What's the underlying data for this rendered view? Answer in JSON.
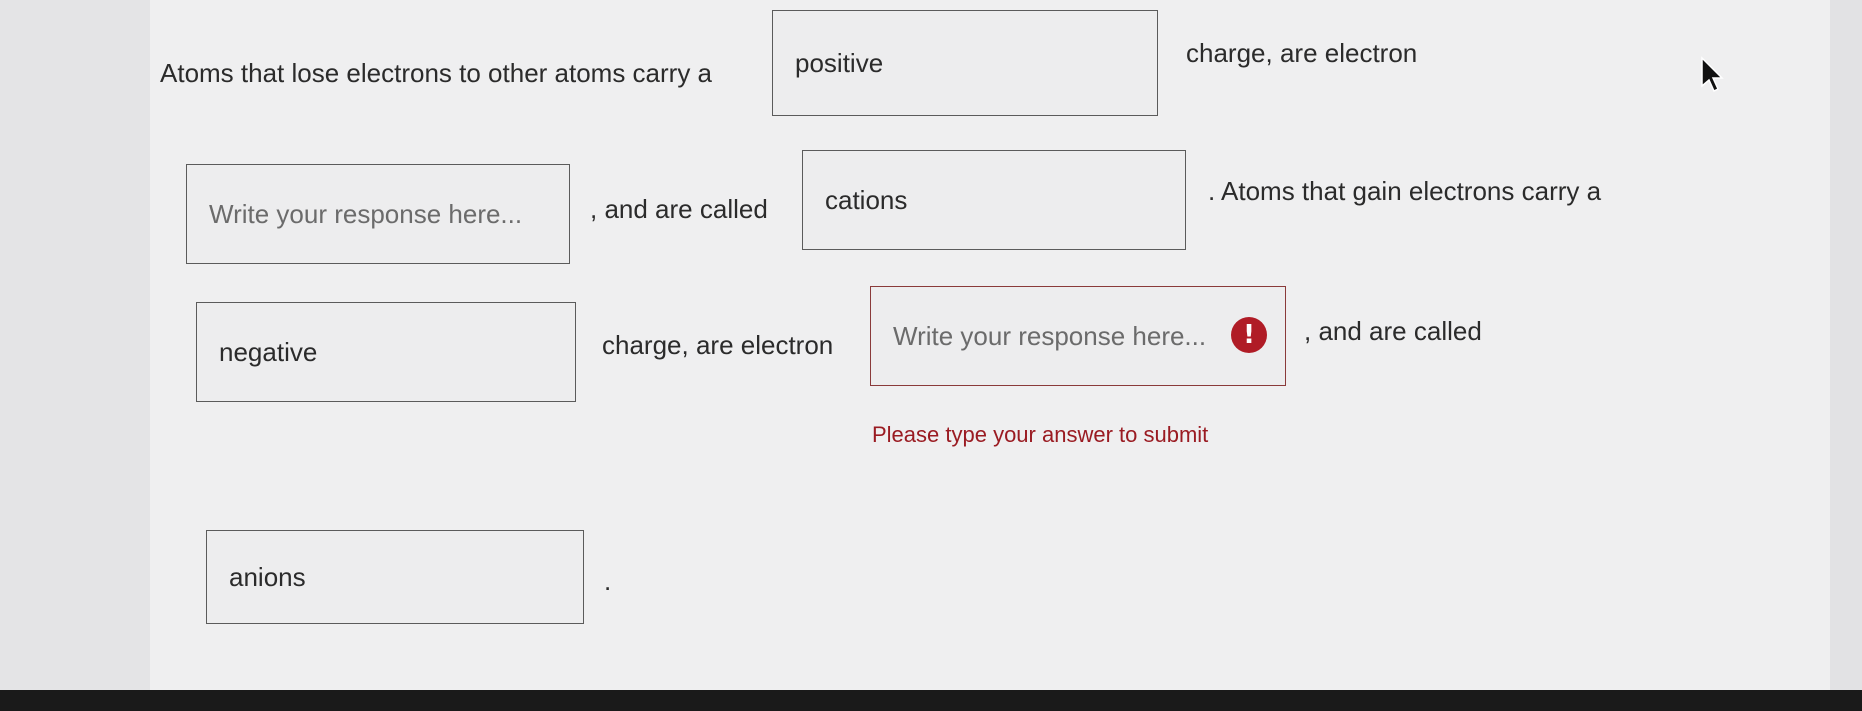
{
  "question": {
    "text_1": "Atoms that lose electrons to other atoms carry a",
    "text_2": "charge, are electron",
    "text_3": ", and are called",
    "text_4": ". Atoms that gain electrons carry a",
    "text_5": "charge, are electron",
    "text_6": ", and are called",
    "text_7": "."
  },
  "inputs": {
    "blank_1": {
      "value": "positive",
      "placeholder": ""
    },
    "blank_2": {
      "value": "",
      "placeholder": "Write your response here..."
    },
    "blank_3": {
      "value": "cations",
      "placeholder": ""
    },
    "blank_4": {
      "value": "negative",
      "placeholder": ""
    },
    "blank_5": {
      "value": "",
      "placeholder": "Write your response here..."
    },
    "blank_6": {
      "value": "anions",
      "placeholder": ""
    }
  },
  "validation": {
    "icon": "!",
    "message": "Please type your answer to submit"
  },
  "colors": {
    "error": "#b01c26",
    "error_text": "#9a1b22"
  }
}
